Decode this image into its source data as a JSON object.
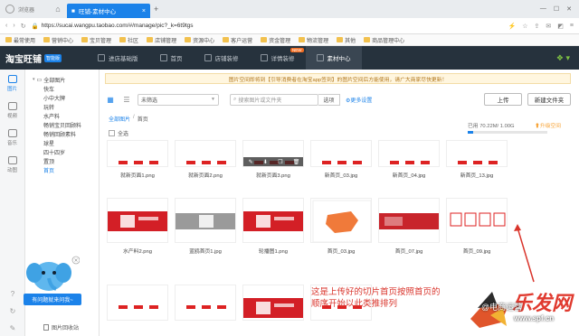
{
  "browser": {
    "app_name": "浏览器",
    "tab_title": "旺铺-素材中心",
    "url": "https://sucai.wangpu.taobao.com/#/manage/pic?_k=6t9tgs",
    "bookmarks": [
      "最常使用",
      "营销中心",
      "宝贝管理",
      "社区",
      "店铺管理",
      "资源中心",
      "客户运营",
      "资金管理",
      "物流管理",
      "其他",
      "商品管理中心"
    ]
  },
  "app": {
    "brand": "淘宝旺铺",
    "brand_badge": "智能版",
    "nav": [
      {
        "label": "进店基础版",
        "active": false
      },
      {
        "label": "首页",
        "active": false
      },
      {
        "label": "店铺装修",
        "active": false
      },
      {
        "label": "详情装修",
        "active": false,
        "badge": "NEW"
      },
      {
        "label": "素材中心",
        "active": true
      }
    ]
  },
  "rail": [
    {
      "label": "图片",
      "icon": "image-icon",
      "active": true
    },
    {
      "label": "视频",
      "icon": "video-icon",
      "active": false
    },
    {
      "label": "音乐",
      "icon": "music-icon",
      "active": false
    },
    {
      "label": "动图",
      "icon": "gif-icon",
      "active": false
    }
  ],
  "tree": {
    "root": "全部图片",
    "children": [
      "快车",
      "小中大牌",
      "玩转",
      "水产料",
      "畅销宝贝回顾料",
      "畅销回顾素料",
      "球星",
      "四十四岁",
      "置顶",
      "首页"
    ],
    "selected": "首页",
    "recycle_label": "图片回收站"
  },
  "main": {
    "notice": "图片空间即将到【引导消费者在淘宝app签到】的图片空间后方能使用，请广大商家尽快更新！",
    "filter_value": "未筛选",
    "search_placeholder": "搜索图片或文件夹",
    "search_scope": "选项",
    "more_settings": "更多设置",
    "upload_label": "上传",
    "new_folder_label": "新建文件夹",
    "breadcrumb": [
      "全部图片",
      "首页"
    ],
    "select_all": "全选",
    "usage_text": "已用 70.22M/ 1.00G",
    "usage_fraction": 0.07,
    "upgrade_label": "升级空间"
  },
  "images_row1": [
    "就新页面1.png",
    "就新页面2.png",
    "就新页面3.png",
    "新首页_03.jpg",
    "新首页_04.jpg",
    "新首页_13.jpg"
  ],
  "images_row2": [
    "水产料2.png",
    "蓝鸥首页1.jpg",
    "轮播图1.png",
    "首页_03.jpg",
    "首页_07.jpg",
    "首页_09.jpg"
  ],
  "thumb_tools": [
    "编辑",
    "下载",
    "复制",
    "删除"
  ],
  "help_tip": "有问题就来问我~",
  "annotation": "这是上传好的切片首页按照首页的顺序开始以此类推排列",
  "watermark": {
    "logo_text": "乐发网",
    "site": "www.spf.cn",
    "at_text": "@电商运营"
  }
}
